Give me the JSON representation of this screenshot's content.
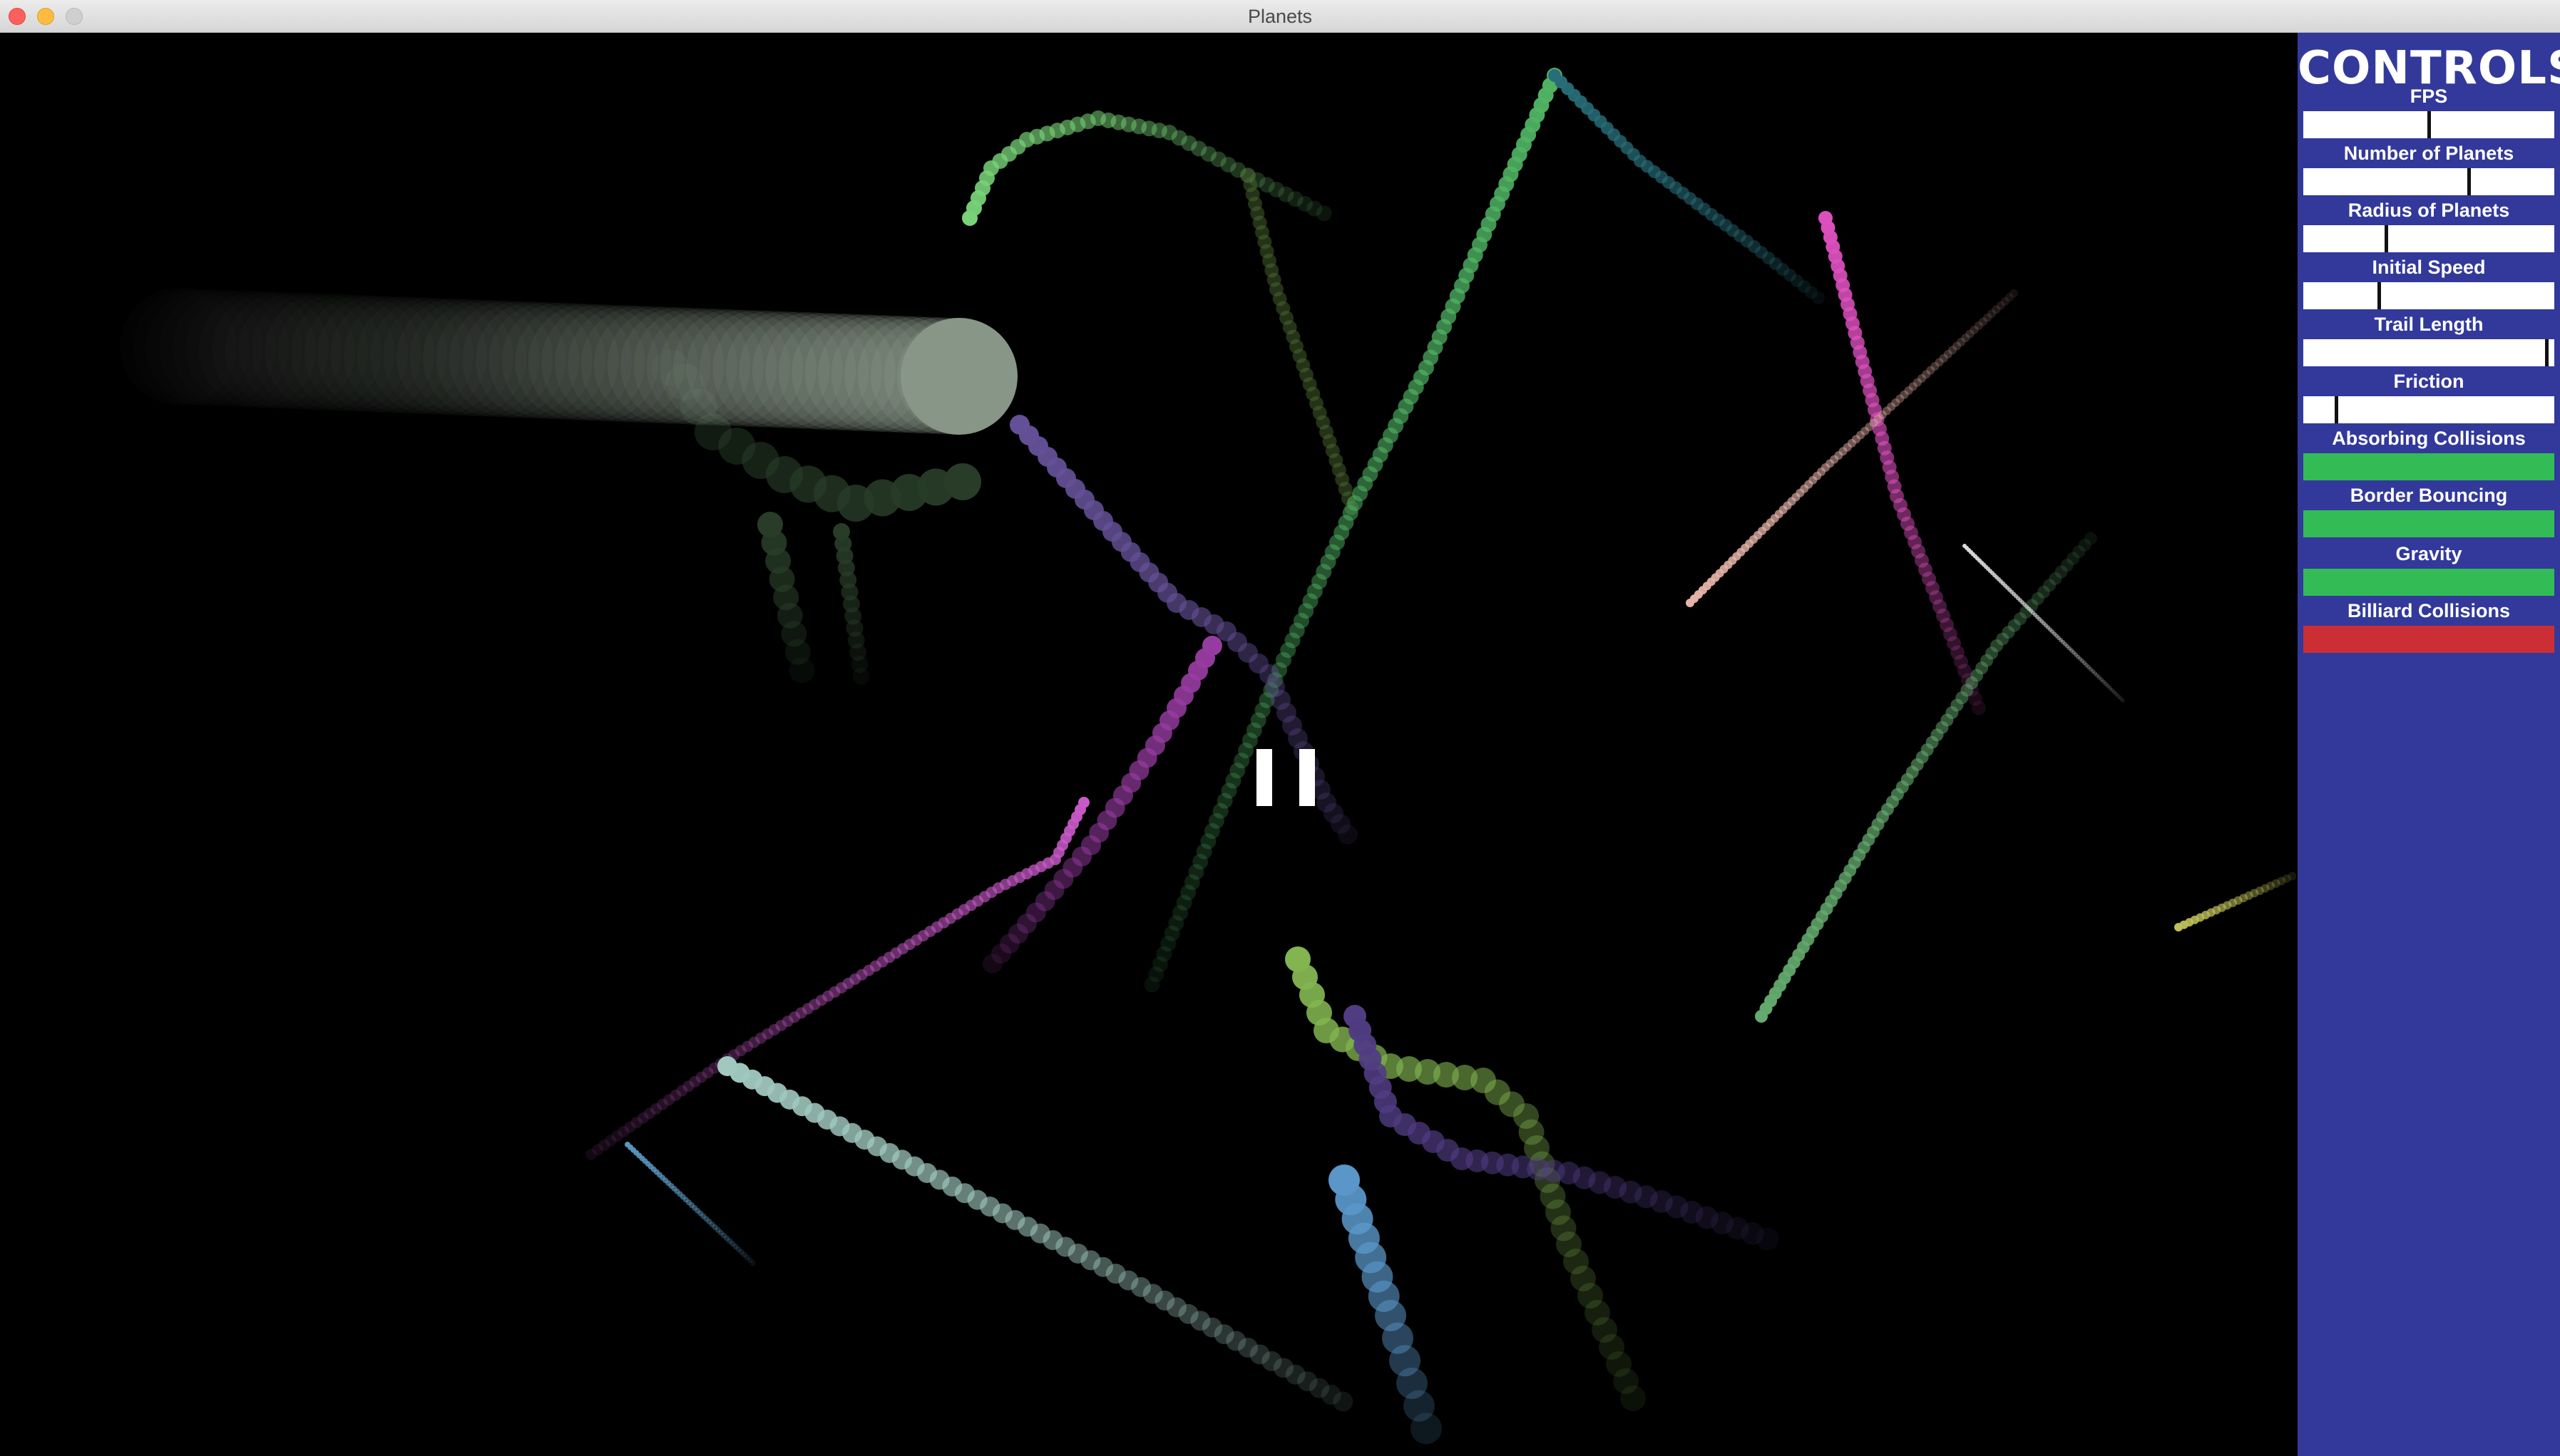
{
  "window": {
    "title": "Planets"
  },
  "canvas": {
    "background": "#000000",
    "paused": true,
    "pause_icon": "pause-icon"
  },
  "controls": {
    "heading": "CONTROLS",
    "background": "#32399a",
    "sliders": [
      {
        "id": "fps",
        "label": "FPS",
        "value": 0.5
      },
      {
        "id": "num-planets",
        "label": "Number of Planets",
        "value": 0.66
      },
      {
        "id": "radius",
        "label": "Radius of Planets",
        "value": 0.33
      },
      {
        "id": "initial-speed",
        "label": "Initial Speed",
        "value": 0.3
      },
      {
        "id": "trail-length",
        "label": "Trail Length",
        "value": 0.97
      },
      {
        "id": "friction",
        "label": "Friction",
        "value": 0.13
      }
    ],
    "toggles": [
      {
        "id": "absorbing-collisions",
        "label": "Absorbing Collisions",
        "on": true,
        "color": "#33bb55"
      },
      {
        "id": "border-bouncing",
        "label": "Border Bouncing",
        "on": true,
        "color": "#33bb55"
      },
      {
        "id": "gravity",
        "label": "Gravity",
        "on": true,
        "color": "#33bb55"
      },
      {
        "id": "billiard-collisions",
        "label": "Billiard Collisions",
        "on": false,
        "color": "#cc2e35"
      }
    ]
  }
}
